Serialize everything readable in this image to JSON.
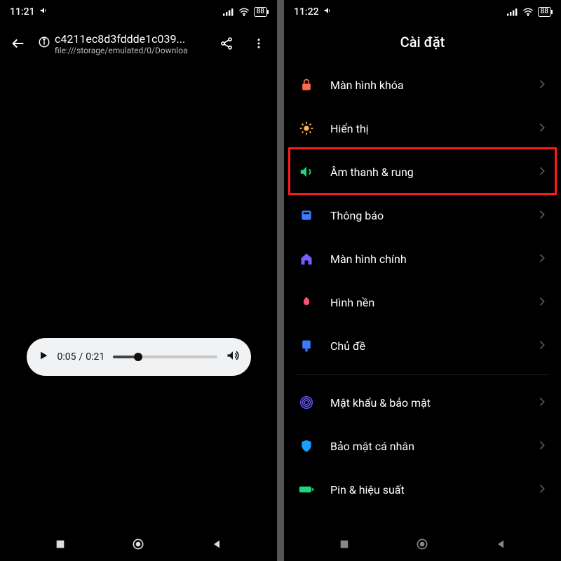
{
  "left": {
    "status": {
      "time": "11:21",
      "battery": "88"
    },
    "browser": {
      "title": "c4211ec8d3fddde1c039...",
      "subtitle": "file:///storage/emulated/0/Downloa"
    },
    "audio": {
      "current": "0:05",
      "duration": "0:21",
      "progress_pct": 24
    }
  },
  "right": {
    "status": {
      "time": "11:22",
      "battery": "88"
    },
    "title": "Cài đặt",
    "items": [
      {
        "label": "Màn hình khóa",
        "icon": "lock-icon",
        "color": "#ff6a4d"
      },
      {
        "label": "Hiển thị",
        "icon": "sun-icon",
        "color": "#ffb84d"
      },
      {
        "label": "Âm thanh & rung",
        "icon": "volume-icon",
        "color": "#1ed67d",
        "highlight": true
      },
      {
        "label": "Thông báo",
        "icon": "notification-icon",
        "color": "#3a7bff"
      },
      {
        "label": "Màn hình chính",
        "icon": "home-icon",
        "color": "#7b5bff"
      },
      {
        "label": "Hình nền",
        "icon": "wallpaper-icon",
        "color": "#ff4d7b"
      },
      {
        "label": "Chủ đề",
        "icon": "theme-icon",
        "color": "#3a7bff"
      }
    ],
    "items2": [
      {
        "label": "Mật khẩu & bảo mật",
        "icon": "fingerprint-icon",
        "color": "#6a5bff"
      },
      {
        "label": "Bảo mật cá nhân",
        "icon": "shield-icon",
        "color": "#1aa0ff"
      },
      {
        "label": "Pin & hiệu suất",
        "icon": "battery-icon",
        "color": "#1ed67d"
      }
    ]
  }
}
